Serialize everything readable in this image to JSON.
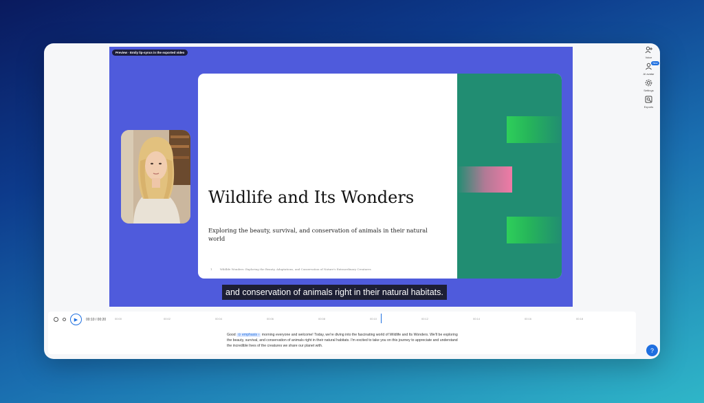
{
  "preview": {
    "badge": "Preview · Emily lip-syncs in the exported video",
    "caption": "and conservation of animals right in their natural habitats."
  },
  "slide": {
    "title": "Wildlife and Its Wonders",
    "subtitle": "Exploring the beauty, survival, and conservation of animals in their natural world",
    "footer_num": "1",
    "footer_text": "Wildlife Wonders: Exploring the Beauty, Adaptations, and Conservation of Nature's Extraordinary Creatures"
  },
  "rightbar": {
    "items": [
      {
        "label": "Voice",
        "icon": "voice-icon"
      },
      {
        "label": "AI avatar",
        "icon": "ai-avatar-icon",
        "badge": "New"
      },
      {
        "label": "Settings",
        "icon": "gear-icon"
      },
      {
        "label": "Exports",
        "icon": "export-icon"
      }
    ]
  },
  "timeline": {
    "time": "00:10 / 00:20",
    "ticks": [
      "00:00",
      "00:02",
      "00:04",
      "00:06",
      "00:08",
      "00:10",
      "00:12",
      "00:14",
      "00:16",
      "00:18"
    ],
    "script_before": "Good",
    "emphasis": "emphasis",
    "script_after": "morning everyone and welcome! Today, we're diving into the fascinating world of Wildlife and Its Wonders. We'll be exploring the beauty, survival, and conservation of animals right in their natural habitats. I'm excited to take you on this journey to appreciate and understand the incredible lives of the creatures we share our planet with."
  },
  "colors": {
    "preview_bg": "#4f5bdc",
    "slide_green": "#218d72",
    "accent": "#1e6fe0"
  }
}
